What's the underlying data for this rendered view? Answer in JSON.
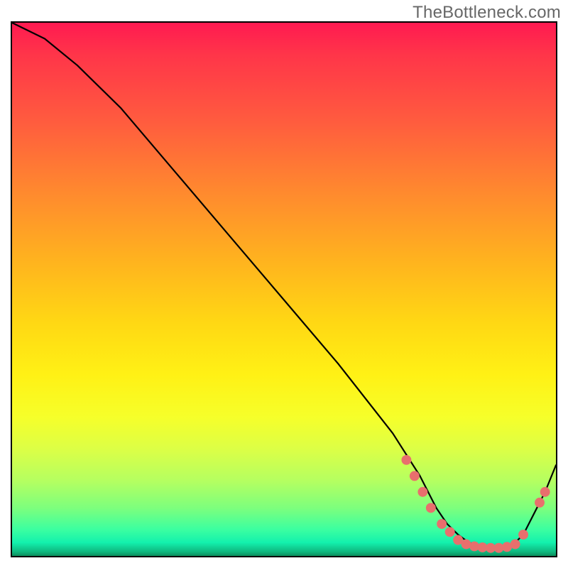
{
  "watermark": "TheBottleneck.com",
  "chart_data": {
    "type": "line",
    "title": "",
    "xlabel": "",
    "ylabel": "",
    "xlim": [
      0,
      100
    ],
    "ylim": [
      0,
      100
    ],
    "grid": false,
    "legend": false,
    "series": [
      {
        "name": "curve",
        "x": [
          0,
          6,
          12,
          20,
          30,
          40,
          50,
          60,
          70,
          75,
          78,
          80,
          82,
          84,
          86,
          88,
          90,
          92,
          94,
          98,
          100
        ],
        "values": [
          100,
          97,
          92,
          84,
          72,
          60,
          48,
          36,
          23,
          15,
          9,
          6,
          4,
          2.5,
          1.8,
          1.5,
          1.5,
          2,
          4,
          12,
          17
        ]
      }
    ],
    "markers": [
      {
        "x": 72.5,
        "y": 18
      },
      {
        "x": 74,
        "y": 15
      },
      {
        "x": 75.5,
        "y": 12
      },
      {
        "x": 77,
        "y": 9
      },
      {
        "x": 79,
        "y": 6
      },
      {
        "x": 80.5,
        "y": 4.5
      },
      {
        "x": 82,
        "y": 3
      },
      {
        "x": 83.5,
        "y": 2.2
      },
      {
        "x": 85,
        "y": 1.8
      },
      {
        "x": 86.5,
        "y": 1.6
      },
      {
        "x": 88,
        "y": 1.5
      },
      {
        "x": 89.5,
        "y": 1.5
      },
      {
        "x": 91,
        "y": 1.7
      },
      {
        "x": 92.5,
        "y": 2.2
      },
      {
        "x": 94,
        "y": 4
      },
      {
        "x": 97,
        "y": 10
      },
      {
        "x": 98,
        "y": 12
      }
    ],
    "marker_color": "#e86f6d",
    "line_color": "#000000"
  }
}
